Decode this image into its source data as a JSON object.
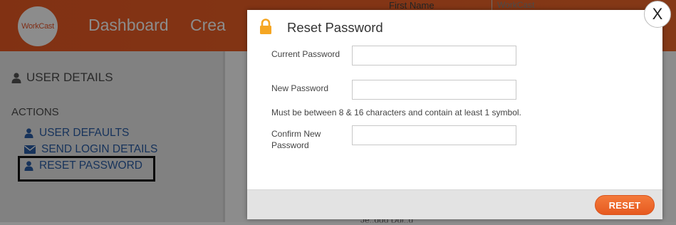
{
  "header": {
    "logo_text": "WorkCast",
    "nav": [
      "Dashboard",
      "Crea"
    ]
  },
  "sidebar": {
    "title": "USER DETAILS",
    "actions_heading": "ACTIONS",
    "links": [
      {
        "label": "USER DEFAULTS",
        "icon": "user-icon"
      },
      {
        "label": "SEND LOGIN DETAILS",
        "icon": "envelope-icon"
      },
      {
        "label": "RESET PASSWORD",
        "icon": "user-icon"
      }
    ]
  },
  "background": {
    "first_name_label": "First Name",
    "first_name_value": "WorkCast",
    "bottom_text": "Je..ddd Dui..u"
  },
  "modal": {
    "title": "Reset Password",
    "fields": {
      "current_password": {
        "label": "Current Password",
        "value": ""
      },
      "new_password": {
        "label": "New Password",
        "value": ""
      },
      "confirm_password": {
        "label": "Confirm New Password",
        "value": ""
      }
    },
    "hint": "Must be between 8 & 16 characters and contain at least 1 symbol.",
    "reset_label": "RESET",
    "close_label": "X"
  },
  "colors": {
    "brand_orange": "#ec5a24",
    "link_blue": "#2b5ea7",
    "lock_orange": "#f5a623"
  }
}
